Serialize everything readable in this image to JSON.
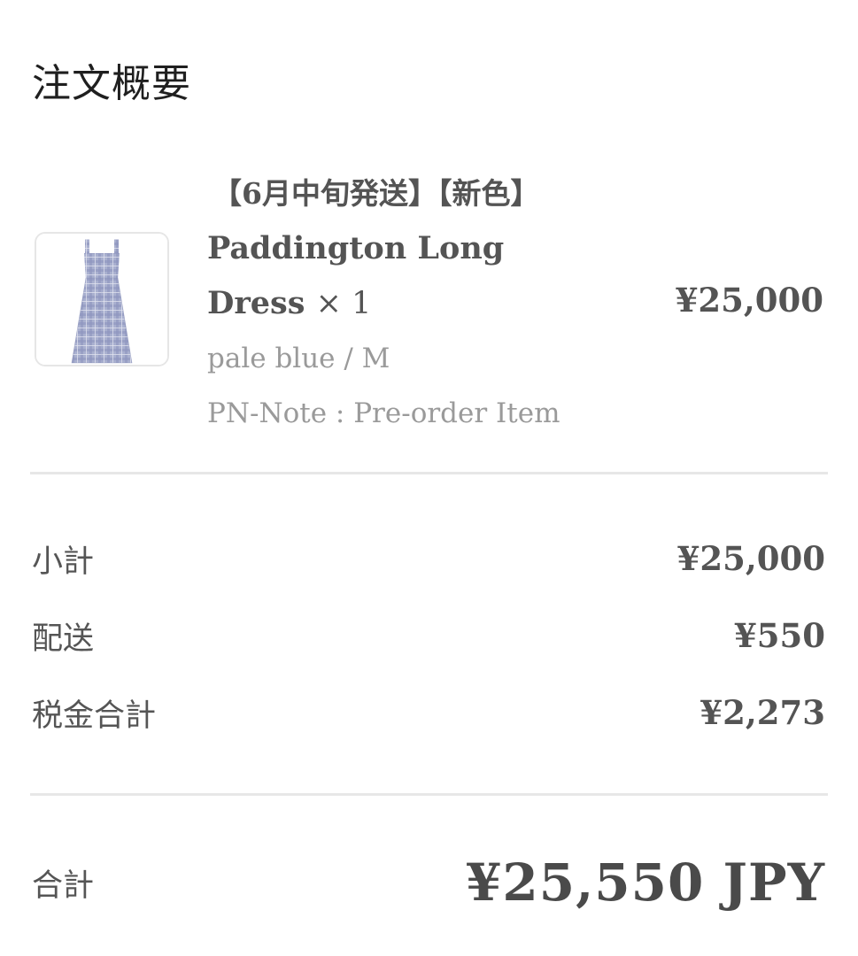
{
  "page": {
    "title": "注文概要"
  },
  "product": {
    "title_line1": "【6月中旬発送】【新色】",
    "title_line2": "Paddington Long",
    "title_line3": "Dress",
    "quantity": "× 1",
    "variant": "pale blue / M",
    "note": "PN-Note : Pre-order Item",
    "price": "¥25,000",
    "image_icon": "dress-thumbnail-image"
  },
  "summary": {
    "subtotal_label": "小計",
    "subtotal_value": "¥25,000",
    "shipping_label": "配送",
    "shipping_value": "¥550",
    "tax_label": "税金合計",
    "tax_value": "¥2,273",
    "total_label": "合計",
    "total_value": "¥25,550 JPY"
  },
  "colors": {
    "divider": "#e7e7e7",
    "text_primary": "#545454",
    "text_muted": "#9a9a9a",
    "dress_fabric": "#9ea6c8"
  }
}
